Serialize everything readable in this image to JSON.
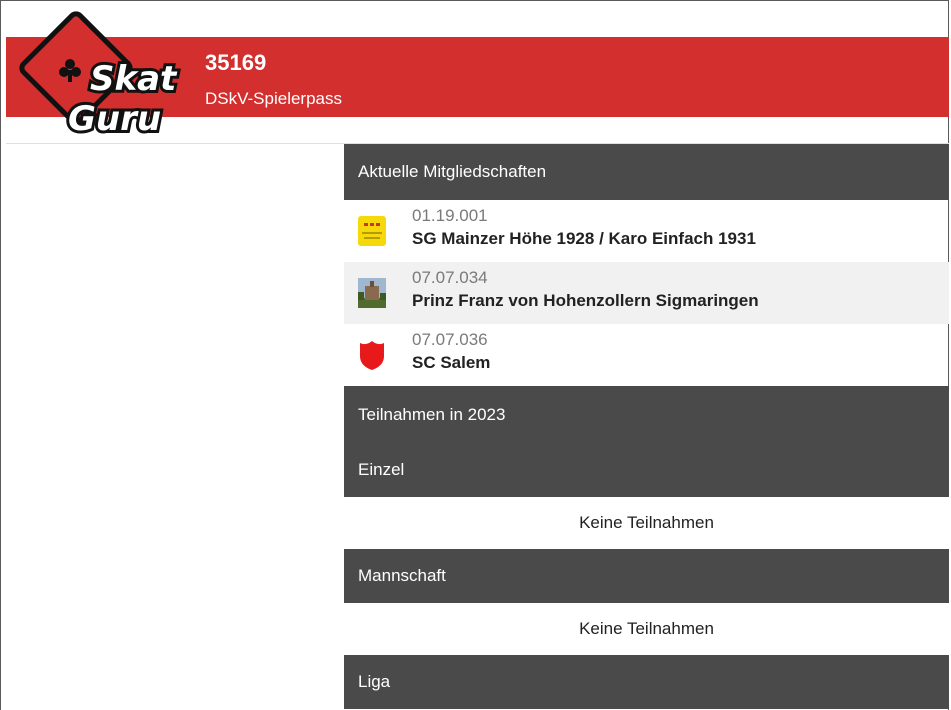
{
  "header": {
    "logo_text_line1": "Skat",
    "logo_text_line2": "Guru",
    "player_id": "35169",
    "subtitle": "DSkV-Spielerpass",
    "brand_color": "#d32f2f"
  },
  "memberships": {
    "heading": "Aktuelle Mitgliedschaften",
    "items": [
      {
        "code": "01.19.001",
        "name": "SG Mainzer Höhe 1928 / Karo Einfach 1931",
        "icon": "yellow-club-crest-icon"
      },
      {
        "code": "07.07.034",
        "name": "Prinz Franz von Hohenzollern Sigmaringen",
        "icon": "castle-photo-icon"
      },
      {
        "code": "07.07.036",
        "name": "SC Salem",
        "icon": "red-shield-icon"
      }
    ]
  },
  "participation": {
    "heading": "Teilnahmen in 2023",
    "sections": [
      {
        "heading": "Einzel",
        "empty_text": "Keine Teilnahmen"
      },
      {
        "heading": "Mannschaft",
        "empty_text": "Keine Teilnahmen"
      },
      {
        "heading": "Liga"
      }
    ]
  },
  "colors": {
    "section_header_bg": "#4a4a4a",
    "alt_row_bg": "#f1f1f1",
    "shield_red": "#e8191a"
  }
}
